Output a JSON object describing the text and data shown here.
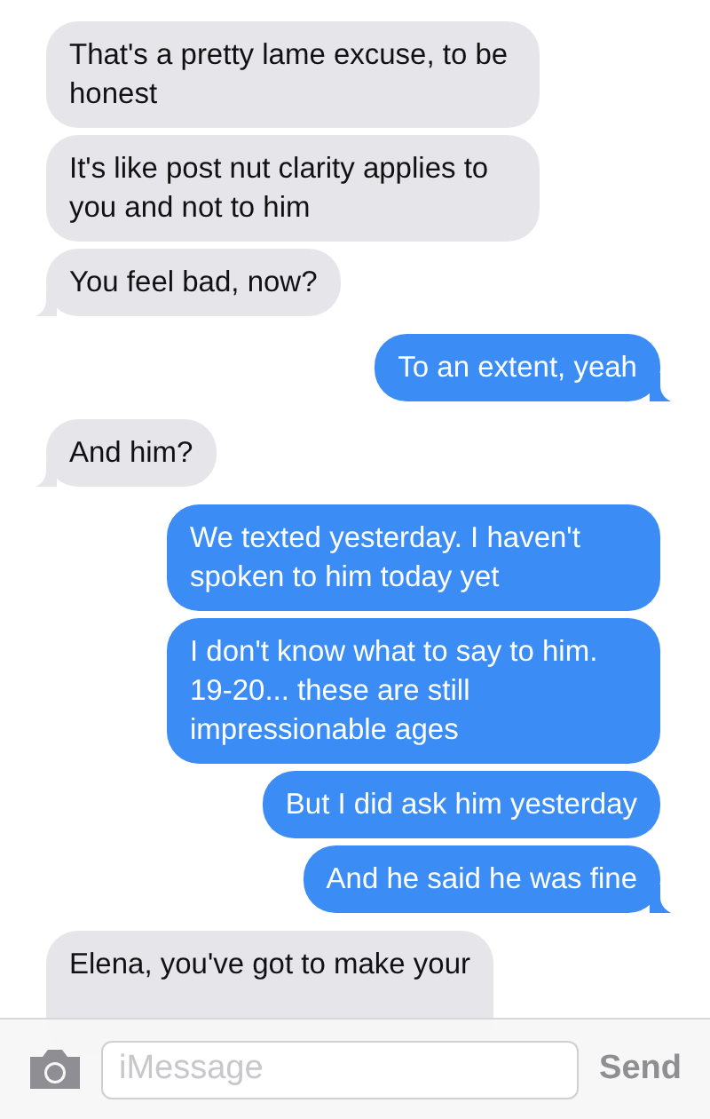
{
  "messages": [
    {
      "kind": "received",
      "text": "That's a pretty lame excuse, to be honest",
      "tail": false
    },
    {
      "kind": "received",
      "text": "It's like post nut clarity applies to you and not to him",
      "tail": false
    },
    {
      "kind": "received",
      "text": "You feel bad, now?",
      "tail": true
    },
    {
      "kind": "sent",
      "text": "To an extent, yeah",
      "tail": true
    },
    {
      "kind": "received",
      "text": "And him?",
      "tail": true
    },
    {
      "kind": "sent",
      "text": "We texted yesterday. I haven't spoken to him today yet",
      "tail": false
    },
    {
      "kind": "sent",
      "text": "I don't know what to say to him. 19-20... these are still impressionable ages",
      "tail": false
    },
    {
      "kind": "sent",
      "text": "But I did ask him yesterday",
      "tail": false
    },
    {
      "kind": "sent",
      "text": "And he said he was fine",
      "tail": true
    },
    {
      "kind": "received",
      "text": "Elena, you've got to make your"
    }
  ],
  "composer": {
    "placeholder": "iMessage",
    "send": "Send"
  }
}
